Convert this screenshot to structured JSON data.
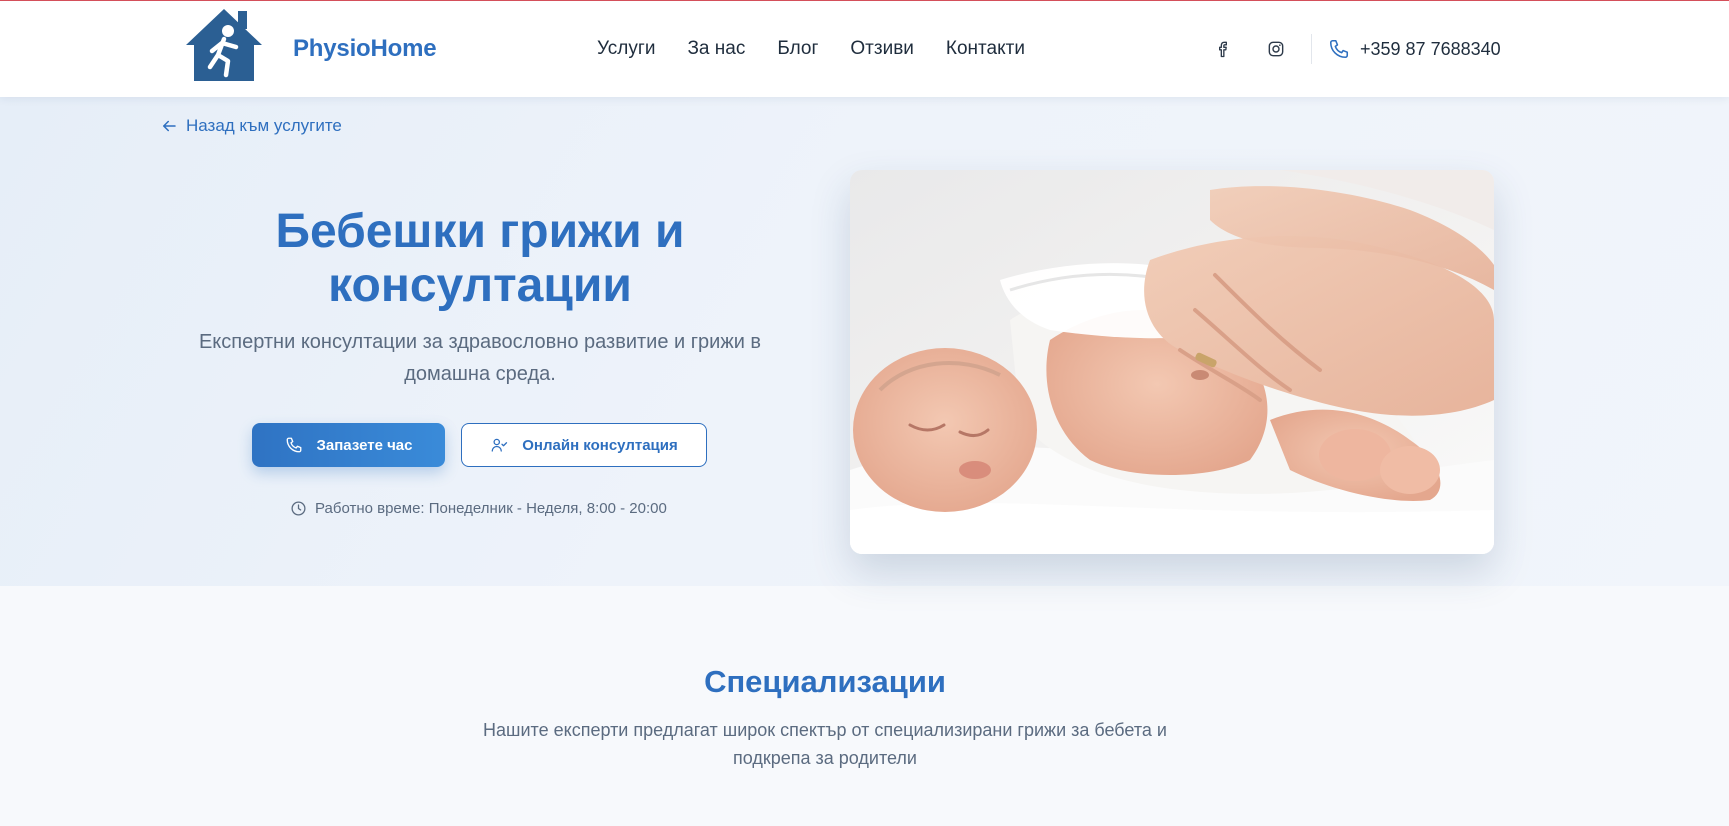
{
  "header": {
    "brand": "PhysioHome",
    "logo_icon": "house-with-running-figure-logo",
    "nav": [
      "Услуги",
      "За нас",
      "Блог",
      "Отзиви",
      "Контакти"
    ],
    "social_icons": [
      "facebook-icon",
      "instagram-icon"
    ],
    "phone": "+359 87 7688340",
    "accent_color": "#2e6fbf"
  },
  "hero": {
    "back_link": "Назад към услугите",
    "title": "Бебешки грижи и консултации",
    "subtitle": "Експертни консултации за здравословно развитие и грижи в домашна среда.",
    "primary_button": "Запазете час",
    "secondary_button": "Онлайн консултация",
    "hours": "Работно време: Понеделник - Неделя, 8:00 - 20:00",
    "image_subject": "newborn-baby-massage-photo"
  },
  "specializations": {
    "title": "Специализации",
    "subtitle": "Нашите експерти предлагат широк спектър от специализирани грижи за бебета и подкрепа за родители"
  }
}
